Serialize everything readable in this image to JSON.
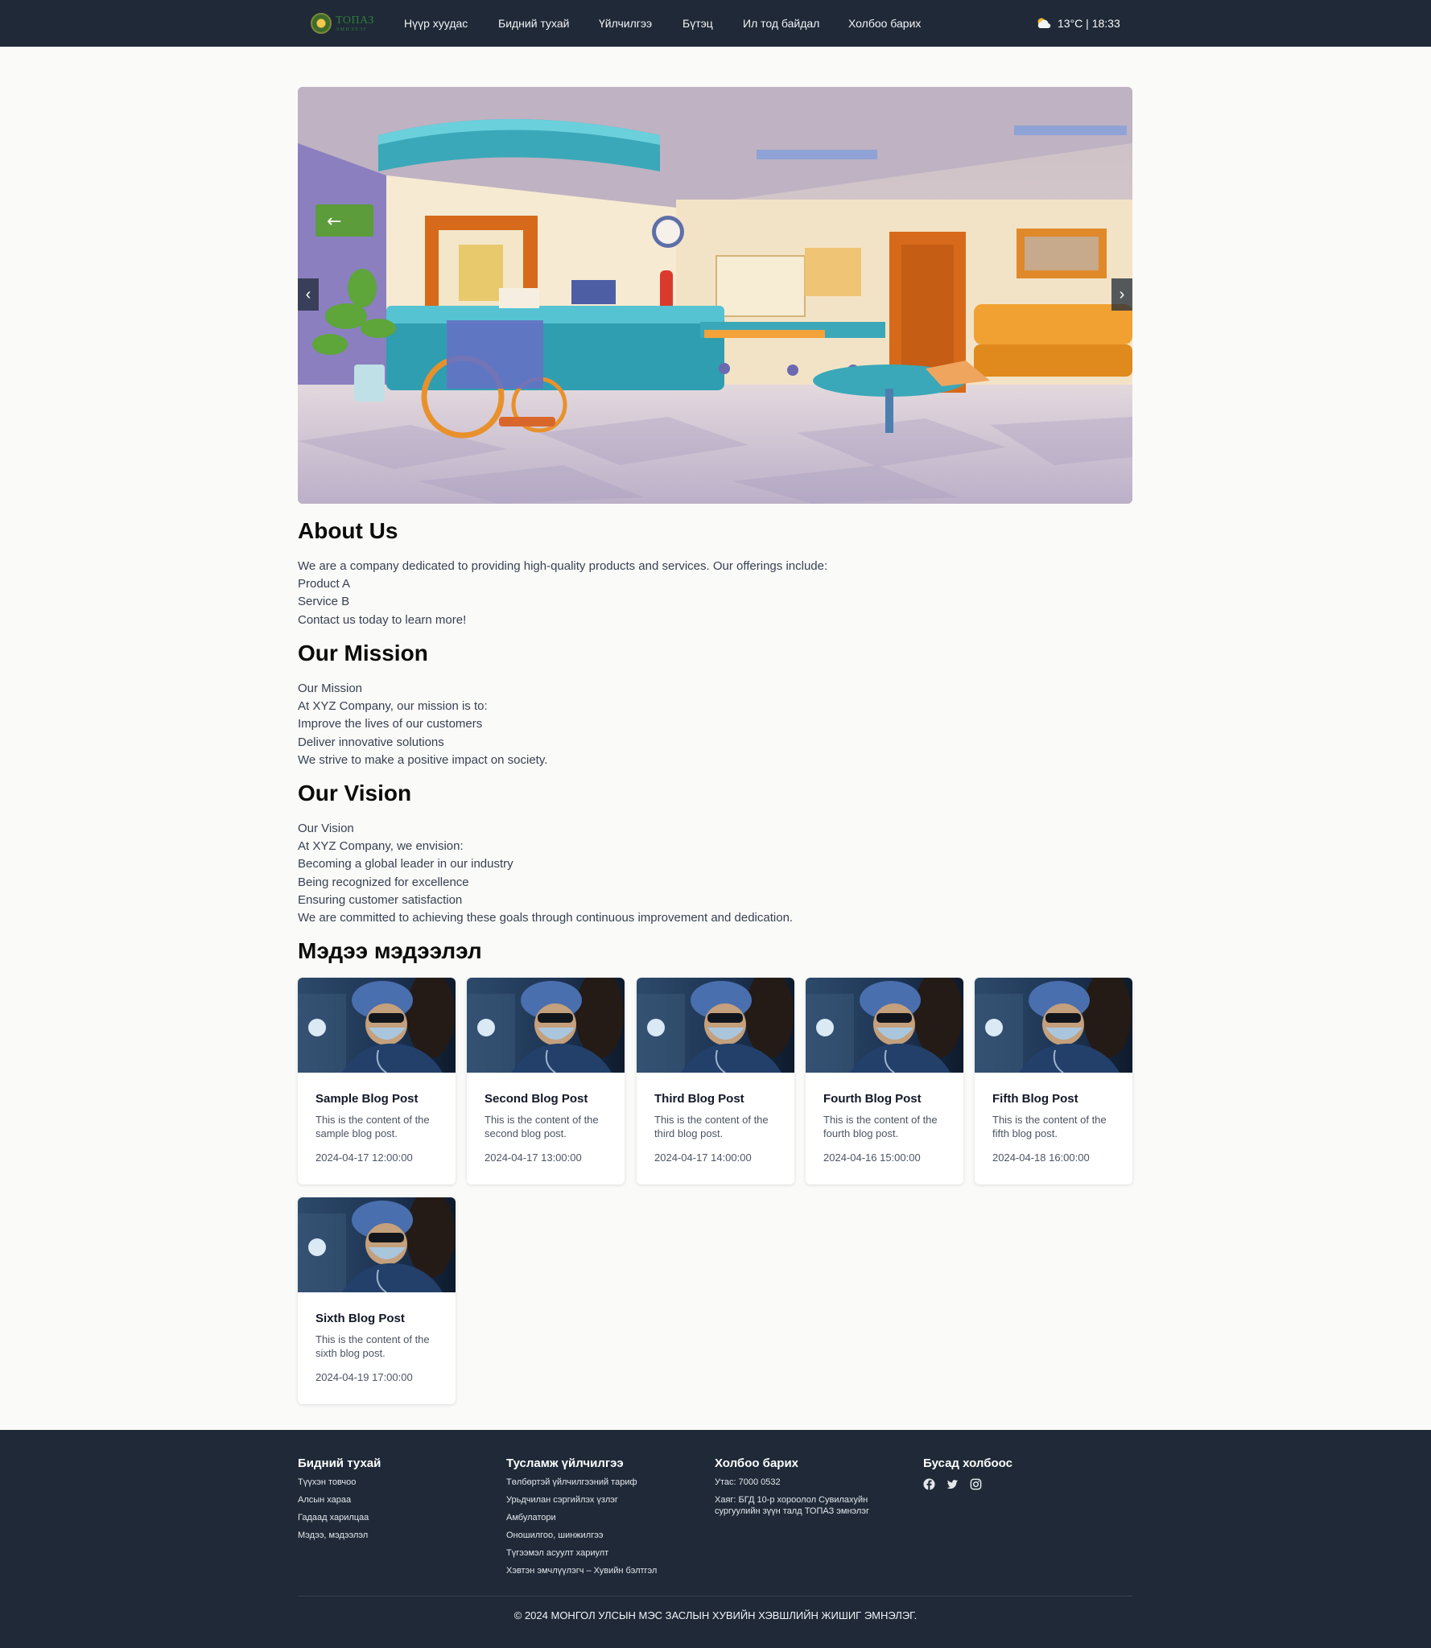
{
  "header": {
    "logo": {
      "line1": "ТОПАЗ",
      "line2": "ЭМНЭЛЭГ"
    },
    "nav": [
      {
        "label": "Нүүр хуудас"
      },
      {
        "label": "Бидний тухай"
      },
      {
        "label": "Үйлчилгээ"
      },
      {
        "label": "Бүтэц"
      },
      {
        "label": "Ил тод байдал"
      },
      {
        "label": "Холбоо барих"
      }
    ],
    "weather": {
      "icon": "partly-cloudy-icon",
      "text": "13°C | 18:33"
    }
  },
  "carousel": {
    "prev_label": "‹",
    "next_label": "›",
    "image": "hospital-lobby-illustration"
  },
  "about": {
    "title": "About Us",
    "lines": [
      "We are a company dedicated to providing high-quality products and services. Our offerings include:",
      "Product A",
      "Service B",
      "Contact us today to learn more!"
    ]
  },
  "mission": {
    "title": "Our Mission",
    "lines": [
      "Our Mission",
      "At XYZ Company, our mission is to:",
      "Improve the lives of our customers",
      "Deliver innovative solutions",
      "We strive to make a positive impact on society."
    ]
  },
  "vision": {
    "title": "Our Vision",
    "lines": [
      "Our Vision",
      "At XYZ Company, we envision:",
      "Becoming a global leader in our industry",
      "Being recognized for excellence",
      "Ensuring customer satisfaction",
      "We are committed to achieving these goals through continuous improvement and dedication."
    ]
  },
  "news": {
    "title": "Мэдээ мэдээлэл",
    "posts": [
      {
        "title": "Sample Blog Post",
        "text": "This is the content of the sample blog post.",
        "date": "2024-04-17 12:00:00"
      },
      {
        "title": "Second Blog Post",
        "text": "This is the content of the second blog post.",
        "date": "2024-04-17 13:00:00"
      },
      {
        "title": "Third Blog Post",
        "text": "This is the content of the third blog post.",
        "date": "2024-04-17 14:00:00"
      },
      {
        "title": "Fourth Blog Post",
        "text": "This is the content of the fourth blog post.",
        "date": "2024-04-16 15:00:00"
      },
      {
        "title": "Fifth Blog Post",
        "text": "This is the content of the fifth blog post.",
        "date": "2024-04-18 16:00:00"
      },
      {
        "title": "Sixth Blog Post",
        "text": "This is the content of the sixth blog post.",
        "date": "2024-04-19 17:00:00"
      }
    ]
  },
  "footer": {
    "about": {
      "title": "Бидний тухай",
      "links": [
        "Түүхэн товчоо",
        "Алсын хараа",
        "Гадаад харилцаа",
        "Мэдээ, мэдээлэл"
      ]
    },
    "services": {
      "title": "Тусламж үйлчилгээ",
      "links": [
        "Төлбөртэй үйлчилгээний тариф",
        "Урьдчилан сэргийлэх үзлэг",
        "Амбулатори",
        "Оношилгоо, шинжилгээ",
        "Түгээмэл асуулт хариулт",
        "Хэвтэн эмчлүүлэгч – Хувийн бэлтгэл"
      ]
    },
    "contact": {
      "title": "Холбоо барих",
      "phone": "Утас: 7000 0532",
      "address_line1": "Хаяг: БГД 10-р хороолол Сувилахуйн",
      "address_line2": "сургуулийн зүүн талд ТОПАЗ эмнэлэг"
    },
    "other": {
      "title": "Бусад холбоос",
      "icons": [
        "facebook-icon",
        "twitter-icon",
        "instagram-icon"
      ]
    },
    "copyright": "© 2024 МОНГОЛ УЛСЫН МЭС ЗАСЛЫН ХУВИЙН ХЭВШЛИЙН ЖИШИГ ЭМНЭЛЭГ."
  }
}
